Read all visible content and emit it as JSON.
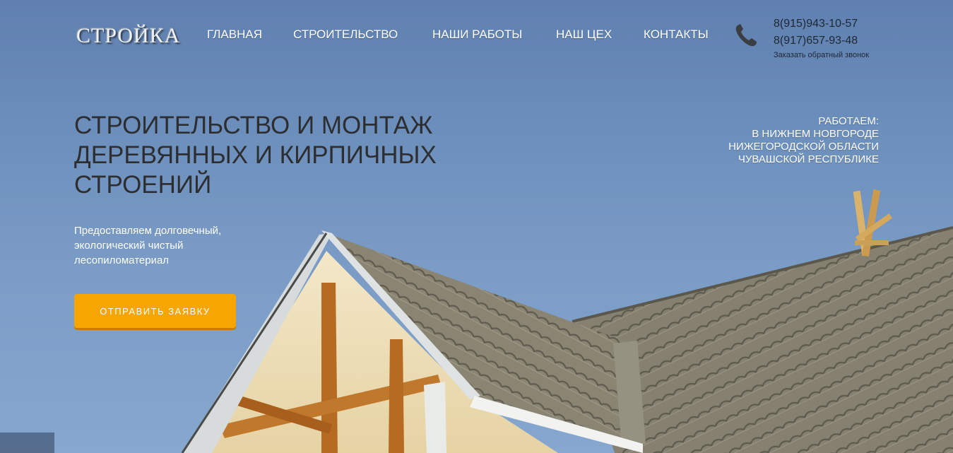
{
  "header": {
    "logo": "СТРОЙКА",
    "nav": [
      {
        "label": "ГЛАВНАЯ"
      },
      {
        "label": "СТРОИТЕЛЬСТВО"
      },
      {
        "label": "НАШИ РАБОТЫ"
      },
      {
        "label": "НАШ ЦЕХ"
      },
      {
        "label": "КОНТАКТЫ"
      }
    ],
    "contacts": {
      "icon": "phone-icon",
      "phone1": "8(915)943-10-57",
      "phone2": "8(917)657-93-48",
      "callback": "Заказать обратный звонок"
    }
  },
  "hero": {
    "headline": [
      "СТРОИТЕЛЬСТВО И МОНТАЖ",
      "ДЕРЕВЯННЫХ И КИРПИЧНЫХ",
      "СТРОЕНИЙ"
    ],
    "areas": [
      "РАБОТАЕМ:",
      "В НИЖНЕМ НОВГОРОДЕ",
      "НИЖЕГОРОДСКОЙ ОБЛАСТИ",
      "ЧУВАШСКОЙ РЕСПУБЛИКЕ"
    ],
    "subtitle": [
      "Предоставляем долговечный,",
      "экологический чистый",
      "лесопиломатериал"
    ],
    "cta": "ОТПРАВИТЬ ЗАЯВКУ"
  },
  "colors": {
    "sky": "#6b8bb8",
    "accent": "#f7a500",
    "headline": "#2c2e31",
    "roof": "#807a68"
  }
}
